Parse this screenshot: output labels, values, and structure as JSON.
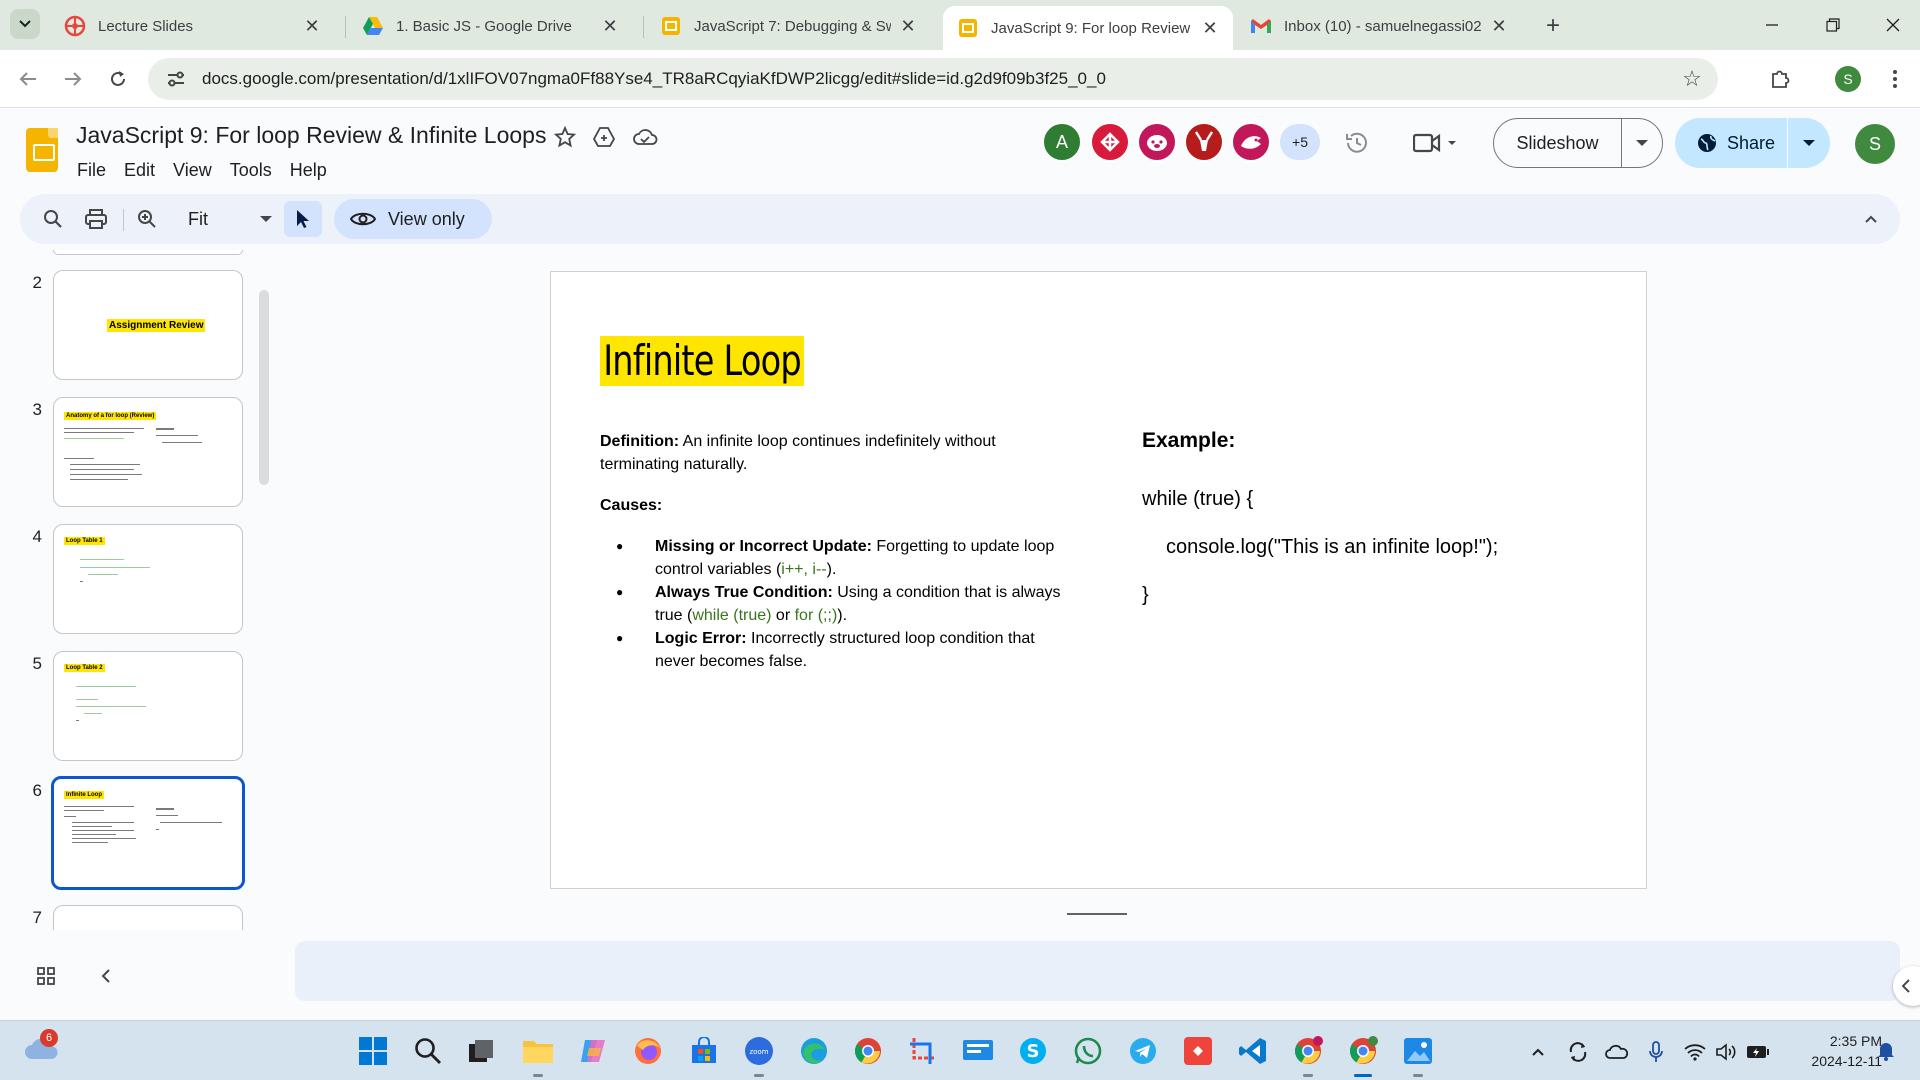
{
  "browser": {
    "tabs": [
      {
        "title": "Lecture Slides",
        "icon": "lecture-favicon",
        "active": false
      },
      {
        "title": "1. Basic JS - Google Drive",
        "icon": "drive-favicon",
        "active": false
      },
      {
        "title": "JavaScript 7: Debugging & Swit",
        "icon": "slides-favicon",
        "active": false
      },
      {
        "title": "JavaScript 9: For loop Review &",
        "icon": "slides-favicon",
        "active": true
      },
      {
        "title": "Inbox (10) - samuelnegassi02@",
        "icon": "gmail-favicon",
        "active": false
      }
    ],
    "url": "docs.google.com/presentation/d/1xlIFOV07ngma0Ff88Yse4_TR8aRCqyiaKfDWP2licgg/edit#slide=id.g2d9f09b3f25_0_0",
    "profile_initial": "S"
  },
  "doc": {
    "title": "JavaScript 9: For loop Review & Infinite Loops",
    "menu": [
      "File",
      "Edit",
      "View",
      "Tools",
      "Help"
    ],
    "collaborators": [
      {
        "initial": "A",
        "color": "#2e7d32"
      },
      {
        "initial": "",
        "color": "#d81b3c"
      },
      {
        "initial": "",
        "color": "#c2185b"
      },
      {
        "initial": "",
        "color": "#b71c1c"
      },
      {
        "initial": "",
        "color": "#c2185b"
      }
    ],
    "more_collaborators": "+5",
    "slideshow_label": "Slideshow",
    "share_label": "Share",
    "account_initial": "S"
  },
  "toolbar": {
    "zoom": "Fit",
    "mode_label": "View only"
  },
  "filmstrip": {
    "slides": [
      {
        "num": "2",
        "title": "Assignment Review"
      },
      {
        "num": "3",
        "title": "Anatomy of a for loop (Review)"
      },
      {
        "num": "4",
        "title": "Loop Table 1"
      },
      {
        "num": "5",
        "title": "Loop Table 2"
      },
      {
        "num": "6",
        "title": "Infinite Loop",
        "active": true
      },
      {
        "num": "7",
        "title": ""
      }
    ]
  },
  "slide": {
    "title": "Infinite Loop",
    "definition_label": "Definition:",
    "definition_text": " An infinite loop continues indefinitely without terminating naturally.",
    "causes_label": "Causes:",
    "causes": [
      {
        "label": "Missing or Incorrect Update:",
        "pre": " Forgetting to update loop control variables (",
        "code1": "i++, i--",
        "mid": "",
        "code2": "",
        "post": ")."
      },
      {
        "label": "Always True Condition:",
        "pre": " Using a condition that is always true (",
        "code1": "while (true)",
        "mid": " or ",
        "code2": "for (;;)",
        "post": ")."
      },
      {
        "label": "Logic Error:",
        "pre": " Incorrectly structured loop condition that never becomes false.",
        "code1": "",
        "mid": "",
        "code2": "",
        "post": ""
      }
    ],
    "example_label": "Example:",
    "code_lines": [
      "while (true) {",
      "console.log(\"This is an infinite loop!\");",
      "}"
    ]
  },
  "taskbar": {
    "notification_count": "6",
    "time": "2:35 PM",
    "date": "2024-12-11"
  }
}
